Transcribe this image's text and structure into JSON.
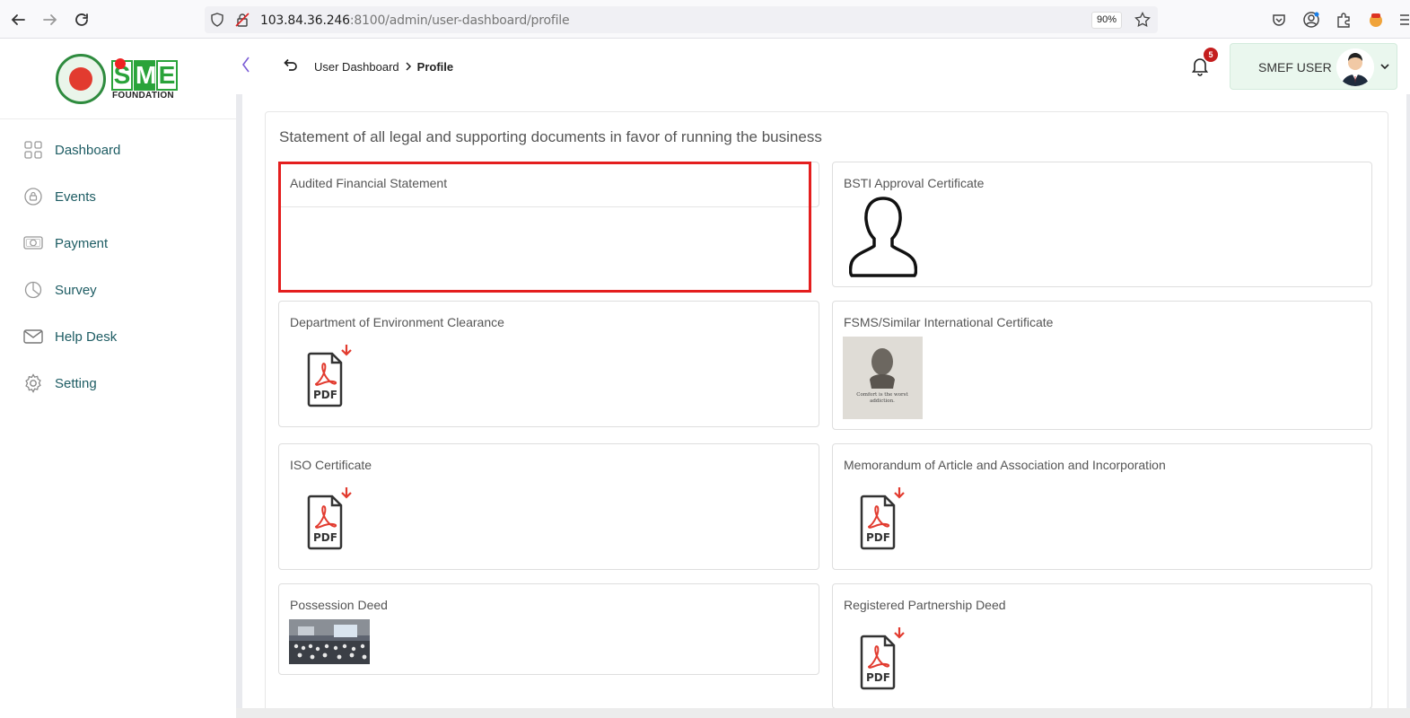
{
  "browser": {
    "url_host": "103.84.36.246",
    "url_rest": ":8100/admin/user-dashboard/profile",
    "zoom": "90%"
  },
  "logo": {
    "letters": [
      "S",
      "M",
      "E"
    ],
    "subtitle": "FOUNDATION"
  },
  "sidebar": {
    "items": [
      {
        "label": "Dashboard",
        "icon": "grid-icon"
      },
      {
        "label": "Events",
        "icon": "lock-circle-icon"
      },
      {
        "label": "Payment",
        "icon": "money-icon"
      },
      {
        "label": "Survey",
        "icon": "pie-chart-icon"
      },
      {
        "label": "Help Desk",
        "icon": "mail-icon"
      },
      {
        "label": "Setting",
        "icon": "gear-icon"
      }
    ]
  },
  "header": {
    "breadcrumb_parent": "User Dashboard",
    "breadcrumb_current": "Profile",
    "notification_count": "5",
    "user_name": "SMEF USER"
  },
  "section": {
    "title": "Statement of all legal and supporting documents in favor of running the business"
  },
  "documents": [
    {
      "title": "Audited Financial Statement",
      "preview": "none"
    },
    {
      "title": "BSTI Approval Certificate",
      "preview": "person-placeholder-icon"
    },
    {
      "title": "Department of Environment Clearance",
      "preview": "pdf-icon"
    },
    {
      "title": "FSMS/Similar International Certificate",
      "preview": "image-thumbnail"
    },
    {
      "title": "ISO Certificate",
      "preview": "pdf-icon"
    },
    {
      "title": "Memorandum of Article and Association and Incorporation",
      "preview": "pdf-icon"
    },
    {
      "title": "Possession Deed",
      "preview": "image-thumbnail"
    },
    {
      "title": "Registered Partnership Deed",
      "preview": "pdf-icon"
    }
  ],
  "pdf_label": "PDF",
  "thumbnail_caption": "Comfort is the worst addiction.",
  "colors": {
    "accent_green": "#2aa33a",
    "menu_text": "#1d5c63",
    "highlight_red": "#e41e1e",
    "badge_red": "#c41e1e"
  }
}
